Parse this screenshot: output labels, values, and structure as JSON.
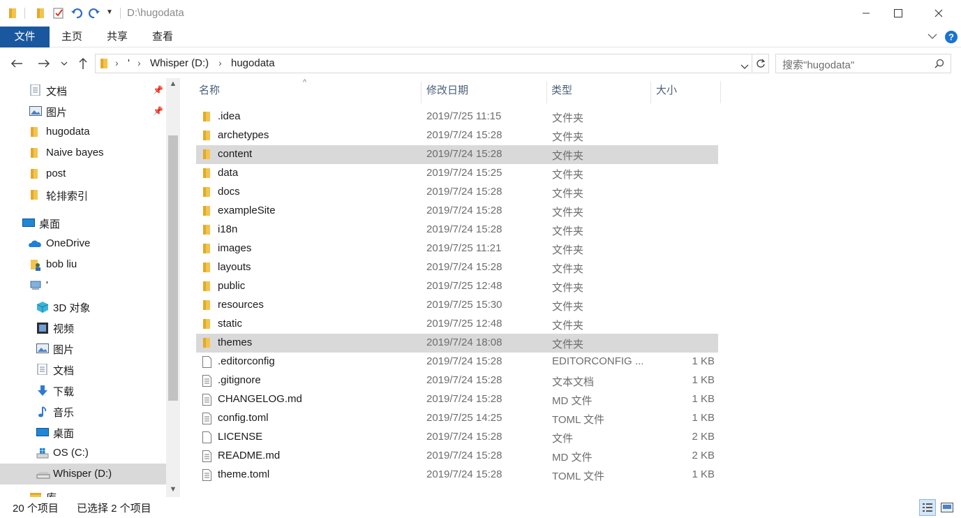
{
  "window": {
    "title": "D:\\hugodata",
    "minimize_icon": "minimize-icon",
    "maximize_icon": "maximize-icon",
    "close_icon": "close-icon"
  },
  "ribbon": {
    "tabs": [
      {
        "label": "文件",
        "active": true
      },
      {
        "label": "主页"
      },
      {
        "label": "共享"
      },
      {
        "label": "查看"
      }
    ],
    "accent": "#19589f"
  },
  "address": {
    "crumbs": [
      "'",
      "Whisper (D:)",
      "hugodata"
    ],
    "search_placeholder": "搜索\"hugodata\""
  },
  "nav": {
    "items": [
      {
        "label": "文档",
        "icon": "documents-icon",
        "pinned": true
      },
      {
        "label": "图片",
        "icon": "pictures-icon",
        "pinned": true
      },
      {
        "label": "hugodata",
        "icon": "folder-icon"
      },
      {
        "label": "Naive bayes",
        "icon": "folder-icon"
      },
      {
        "label": "post",
        "icon": "folder-icon"
      },
      {
        "label": "轮排索引",
        "icon": "folder-icon"
      },
      {
        "label": "桌面",
        "icon": "desktop-icon"
      },
      {
        "label": "OneDrive",
        "icon": "onedrive-icon"
      },
      {
        "label": "bob liu",
        "icon": "user-folder-icon"
      },
      {
        "label": "'",
        "icon": "this-pc-icon"
      },
      {
        "label": "3D 对象",
        "icon": "3d-objects-icon"
      },
      {
        "label": "视频",
        "icon": "videos-icon"
      },
      {
        "label": "图片",
        "icon": "pictures-icon"
      },
      {
        "label": "文档",
        "icon": "documents-icon"
      },
      {
        "label": "下载",
        "icon": "downloads-icon"
      },
      {
        "label": "音乐",
        "icon": "music-icon"
      },
      {
        "label": "桌面",
        "icon": "desktop-icon"
      },
      {
        "label": "OS (C:)",
        "icon": "windows-drive-icon"
      },
      {
        "label": "Whisper (D:)",
        "icon": "drive-icon",
        "selected": true
      },
      {
        "label": "库",
        "icon": "library-icon"
      }
    ]
  },
  "columns": {
    "name": "名称",
    "date": "修改日期",
    "type": "类型",
    "size": "大小"
  },
  "files": [
    {
      "name": ".idea",
      "date": "2019/7/25 11:15",
      "type": "文件夹",
      "size": "",
      "kind": "folder"
    },
    {
      "name": "archetypes",
      "date": "2019/7/24 15:28",
      "type": "文件夹",
      "size": "",
      "kind": "folder"
    },
    {
      "name": "content",
      "date": "2019/7/24 15:28",
      "type": "文件夹",
      "size": "",
      "kind": "folder",
      "selected": true
    },
    {
      "name": "data",
      "date": "2019/7/24 15:25",
      "type": "文件夹",
      "size": "",
      "kind": "folder"
    },
    {
      "name": "docs",
      "date": "2019/7/24 15:28",
      "type": "文件夹",
      "size": "",
      "kind": "folder"
    },
    {
      "name": "exampleSite",
      "date": "2019/7/24 15:28",
      "type": "文件夹",
      "size": "",
      "kind": "folder"
    },
    {
      "name": "i18n",
      "date": "2019/7/24 15:28",
      "type": "文件夹",
      "size": "",
      "kind": "folder"
    },
    {
      "name": "images",
      "date": "2019/7/25 11:21",
      "type": "文件夹",
      "size": "",
      "kind": "folder"
    },
    {
      "name": "layouts",
      "date": "2019/7/24 15:28",
      "type": "文件夹",
      "size": "",
      "kind": "folder"
    },
    {
      "name": "public",
      "date": "2019/7/25 12:48",
      "type": "文件夹",
      "size": "",
      "kind": "folder"
    },
    {
      "name": "resources",
      "date": "2019/7/25 15:30",
      "type": "文件夹",
      "size": "",
      "kind": "folder"
    },
    {
      "name": "static",
      "date": "2019/7/25 12:48",
      "type": "文件夹",
      "size": "",
      "kind": "folder"
    },
    {
      "name": "themes",
      "date": "2019/7/24 18:08",
      "type": "文件夹",
      "size": "",
      "kind": "folder",
      "selected": true
    },
    {
      "name": ".editorconfig",
      "date": "2019/7/24 15:28",
      "type": "EDITORCONFIG ...",
      "size": "1 KB",
      "kind": "file"
    },
    {
      "name": ".gitignore",
      "date": "2019/7/24 15:28",
      "type": "文本文档",
      "size": "1 KB",
      "kind": "text"
    },
    {
      "name": "CHANGELOG.md",
      "date": "2019/7/24 15:28",
      "type": "MD 文件",
      "size": "1 KB",
      "kind": "text"
    },
    {
      "name": "config.toml",
      "date": "2019/7/25 14:25",
      "type": "TOML 文件",
      "size": "1 KB",
      "kind": "text"
    },
    {
      "name": "LICENSE",
      "date": "2019/7/24 15:28",
      "type": "文件",
      "size": "2 KB",
      "kind": "file"
    },
    {
      "name": "README.md",
      "date": "2019/7/24 15:28",
      "type": "MD 文件",
      "size": "2 KB",
      "kind": "text"
    },
    {
      "name": "theme.toml",
      "date": "2019/7/24 15:28",
      "type": "TOML 文件",
      "size": "1 KB",
      "kind": "text"
    }
  ],
  "status": {
    "count": "20 个项目",
    "selection": "已选择 2 个项目"
  }
}
